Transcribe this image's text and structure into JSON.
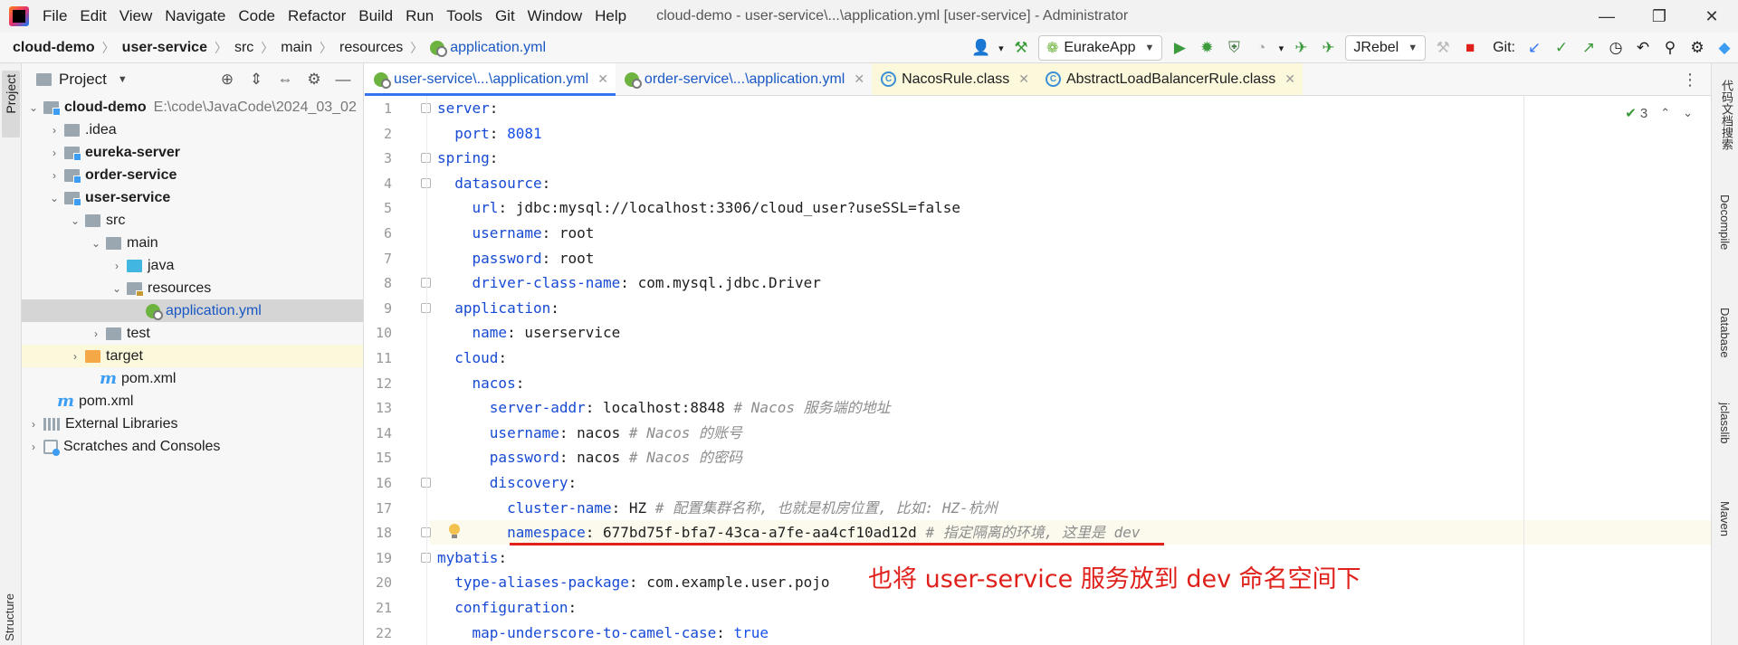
{
  "menu": [
    "File",
    "Edit",
    "View",
    "Navigate",
    "Code",
    "Refactor",
    "Build",
    "Run",
    "Tools",
    "Git",
    "Window",
    "Help"
  ],
  "window_title": "cloud-demo - user-service\\...\\application.yml [user-service] - Administrator",
  "window_controls": {
    "minimize": "—",
    "restore": "❐",
    "close": "✕"
  },
  "breadcrumbs": [
    "cloud-demo",
    "user-service",
    "src",
    "main",
    "resources",
    "application.yml"
  ],
  "toolbar": {
    "run_config": "EurakeApp",
    "jrebel": "JRebel",
    "git_label": "Git:"
  },
  "project_panel": {
    "title": "Project",
    "tree": [
      {
        "label": "cloud-demo",
        "path": "E:\\code\\JavaCode\\2024_03_02",
        "bold": true
      },
      {
        "label": ".idea"
      },
      {
        "label": "eureka-server",
        "bold": true
      },
      {
        "label": "order-service",
        "bold": true
      },
      {
        "label": "user-service",
        "bold": true
      },
      {
        "label": "src"
      },
      {
        "label": "main"
      },
      {
        "label": "java"
      },
      {
        "label": "resources"
      },
      {
        "label": "application.yml"
      },
      {
        "label": "test"
      },
      {
        "label": "target"
      },
      {
        "label": "pom.xml"
      },
      {
        "label": "pom.xml"
      },
      {
        "label": "External Libraries"
      },
      {
        "label": "Scratches and Consoles"
      }
    ]
  },
  "editor": {
    "tabs": [
      {
        "label": "user-service\\...\\application.yml",
        "close": "✕"
      },
      {
        "label": "order-service\\...\\application.yml",
        "close": "✕"
      },
      {
        "label": "NacosRule.class",
        "close": "✕"
      },
      {
        "label": "AbstractLoadBalancerRule.class",
        "close": "✕"
      }
    ],
    "inspection_count": "3",
    "line_numbers": [
      "1",
      "2",
      "3",
      "4",
      "5",
      "6",
      "7",
      "8",
      "9",
      "10",
      "11",
      "12",
      "13",
      "14",
      "15",
      "16",
      "17",
      "18",
      "19",
      "20",
      "21",
      "22"
    ],
    "lines": [
      {
        "indent": "",
        "key": "server",
        "sep": ":",
        "val": "",
        "cmt": ""
      },
      {
        "indent": "  ",
        "key": "port",
        "sep": ": ",
        "val": "8081",
        "cmt": ""
      },
      {
        "indent": "",
        "key": "spring",
        "sep": ":",
        "val": "",
        "cmt": ""
      },
      {
        "indent": "  ",
        "key": "datasource",
        "sep": ":",
        "val": "",
        "cmt": ""
      },
      {
        "indent": "    ",
        "key": "url",
        "sep": ": ",
        "val": "jdbc:mysql://localhost:3306/cloud_user?useSSL=false",
        "cmt": ""
      },
      {
        "indent": "    ",
        "key": "username",
        "sep": ": ",
        "val": "root",
        "cmt": ""
      },
      {
        "indent": "    ",
        "key": "password",
        "sep": ": ",
        "val": "root",
        "cmt": ""
      },
      {
        "indent": "    ",
        "key": "driver-class-name",
        "sep": ": ",
        "val": "com.mysql.jdbc.Driver",
        "cmt": ""
      },
      {
        "indent": "  ",
        "key": "application",
        "sep": ":",
        "val": "",
        "cmt": ""
      },
      {
        "indent": "    ",
        "key": "name",
        "sep": ": ",
        "val": "userservice",
        "cmt": ""
      },
      {
        "indent": "  ",
        "key": "cloud",
        "sep": ":",
        "val": "",
        "cmt": ""
      },
      {
        "indent": "    ",
        "key": "nacos",
        "sep": ":",
        "val": "",
        "cmt": ""
      },
      {
        "indent": "      ",
        "key": "server-addr",
        "sep": ": ",
        "val": "localhost:8848 ",
        "cmt": "# Nacos 服务端的地址"
      },
      {
        "indent": "      ",
        "key": "username",
        "sep": ": ",
        "val": "nacos ",
        "cmt": "# Nacos 的账号"
      },
      {
        "indent": "      ",
        "key": "password",
        "sep": ": ",
        "val": "nacos ",
        "cmt": "# Nacos 的密码"
      },
      {
        "indent": "      ",
        "key": "discovery",
        "sep": ":",
        "val": "",
        "cmt": ""
      },
      {
        "indent": "        ",
        "key": "cluster-name",
        "sep": ": ",
        "val": "HZ ",
        "cmt": "# 配置集群名称, 也就是机房位置, 比如: HZ-杭州"
      },
      {
        "indent": "        ",
        "key": "namespace",
        "sep": ": ",
        "val": "677bd75f-bfa7-43ca-a7fe-aa4cf10ad12d ",
        "cmt": "# 指定隔离的环境, 这里是 dev"
      },
      {
        "indent": "",
        "key": "mybatis",
        "sep": ":",
        "val": "",
        "cmt": ""
      },
      {
        "indent": "  ",
        "key": "type-aliases-package",
        "sep": ": ",
        "val": "com.example.user.pojo",
        "cmt": ""
      },
      {
        "indent": "  ",
        "key": "configuration",
        "sep": ":",
        "val": "",
        "cmt": ""
      },
      {
        "indent": "    ",
        "key": "map-underscore-to-camel-case",
        "sep": ": ",
        "val": "true",
        "cmt": ""
      }
    ],
    "annotation": "也将 user-service 服务放到 dev 命名空间下"
  },
  "left_stripe": {
    "project": "Project",
    "structure": "Structure"
  },
  "right_stripe": [
    "代码文档搜索",
    "Decompile",
    "Database",
    "jclasslib",
    "Maven"
  ]
}
